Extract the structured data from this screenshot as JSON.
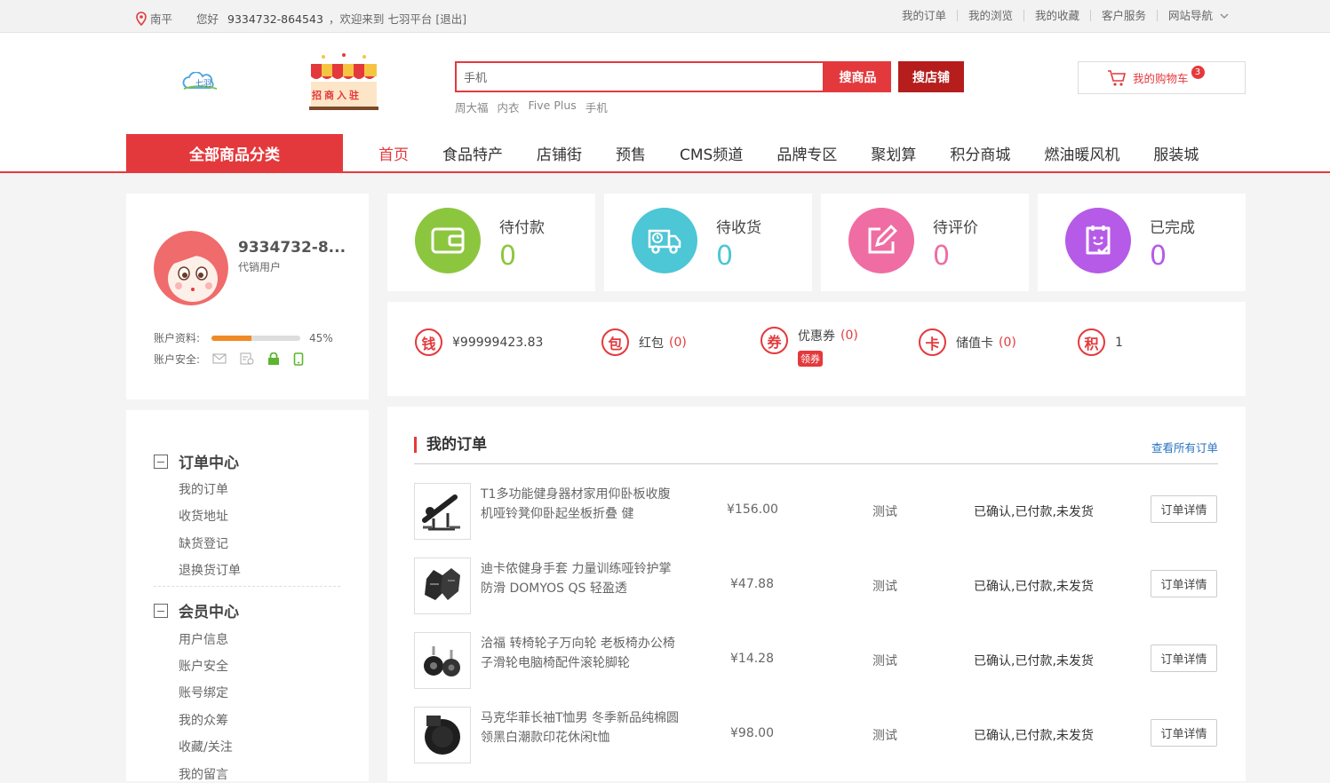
{
  "topbar": {
    "location": "南平",
    "greeting": "您好",
    "user": "9334732-864543",
    "welcome": "，欢迎来到 七羽平台 [退出]",
    "links": [
      "我的订单",
      "我的浏览",
      "我的收藏",
      "客户服务",
      "网站导航"
    ]
  },
  "header": {
    "logo_text": "七羽",
    "shop_logo_text": "招商入驻",
    "search_value": "手机",
    "search_goods_label": "搜商品",
    "search_shop_label": "搜店铺",
    "hot_words": [
      "周大福",
      "内衣",
      "Five Plus",
      "手机"
    ],
    "cart_label": "我的购物车",
    "cart_count": "3"
  },
  "nav": {
    "all_categories": "全部商品分类",
    "items": [
      "首页",
      "食品特产",
      "店铺街",
      "预售",
      "CMS频道",
      "品牌专区",
      "聚划算",
      "积分商城",
      "燃油暖风机",
      "服装城"
    ]
  },
  "profile": {
    "name": "9334732-8...",
    "role": "代销用户",
    "info_label": "账户资料:",
    "info_percent": "45%",
    "info_fraction": 0.45,
    "security_label": "账户安全:"
  },
  "stats": [
    {
      "label": "待付款",
      "value": "0",
      "color": "#8cc63f"
    },
    {
      "label": "待收货",
      "value": "0",
      "color": "#4dc6d6"
    },
    {
      "label": "待评价",
      "value": "0",
      "color": "#ef6da3"
    },
    {
      "label": "已完成",
      "value": "0",
      "color": "#b55be8"
    }
  ],
  "assets": {
    "money": {
      "icon": "钱",
      "value": "¥99999423.83"
    },
    "redpacket": {
      "icon": "包",
      "label": "红包",
      "count": "(0)"
    },
    "coupon": {
      "icon": "券",
      "label": "优惠券",
      "count": "(0)",
      "tag": "领券"
    },
    "card": {
      "icon": "卡",
      "label": "储值卡",
      "count": "(0)"
    },
    "points": {
      "icon": "积",
      "value": "1"
    }
  },
  "menu": {
    "order_center": "订单中心",
    "order_items": [
      "我的订单",
      "收货地址",
      "缺货登记",
      "退换货订单"
    ],
    "member_center": "会员中心",
    "member_items": [
      "用户信息",
      "账户安全",
      "账号绑定",
      "我的众筹",
      "收藏/关注",
      "我的留言"
    ]
  },
  "orders": {
    "title": "我的订单",
    "view_all": "查看所有订单",
    "detail_label": "订单详情",
    "rows": [
      {
        "name": "T1多功能健身器材家用仰卧板收腹机哑铃凳仰卧起坐板折叠 健",
        "price": "¥156.00",
        "seller": "测试",
        "status": "已确认,已付款,未发货"
      },
      {
        "name": "迪卡侬健身手套 力量训练哑铃护掌防滑 DOMYOS QS 轻盈透",
        "price": "¥47.88",
        "seller": "测试",
        "status": "已确认,已付款,未发货"
      },
      {
        "name": "洽福 转椅轮子万向轮 老板椅办公椅子滑轮电脑椅配件滚轮脚轮",
        "price": "¥14.28",
        "seller": "测试",
        "status": "已确认,已付款,未发货"
      },
      {
        "name": "马克华菲长袖T恤男 冬季新品纯棉圆领黑白潮款印花休闲t恤",
        "price": "¥98.00",
        "seller": "测试",
        "status": "已确认,已付款,未发货"
      }
    ]
  }
}
